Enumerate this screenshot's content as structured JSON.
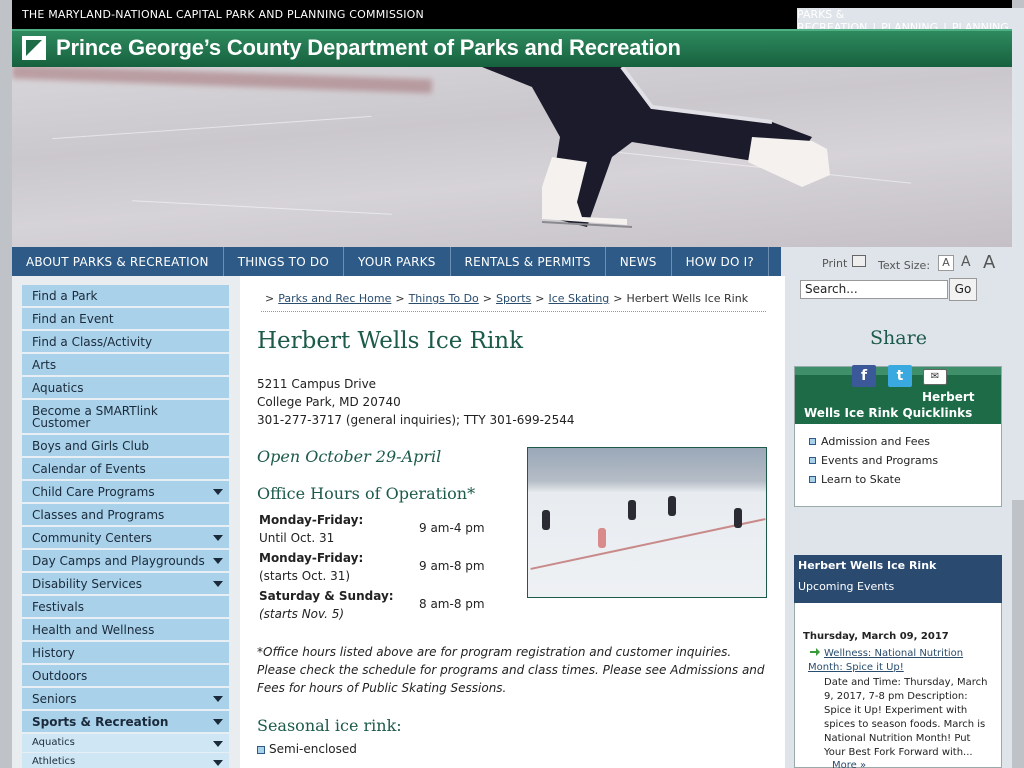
{
  "topbar": {
    "org": "THE MARYLAND-NATIONAL CAPITAL PARK AND PLANNING COMMISSION",
    "links": [
      "PARKS & RECREATION",
      "PLANNING",
      "PLANNING BOARD"
    ],
    "sep": "|"
  },
  "banner": {
    "title": "Prince George’s County Department of Parks and Recreation"
  },
  "nav": {
    "items": [
      "ABOUT PARKS & RECREATION",
      "THINGS TO DO",
      "YOUR PARKS",
      "RENTALS & PERMITS",
      "NEWS",
      "HOW DO I?"
    ],
    "print": "Print",
    "text_size": "Text Size:",
    "size_small": "A",
    "size_medium": "A",
    "size_large": "A"
  },
  "sidebar": {
    "items": [
      "Find a Park",
      "Find an Event",
      "Find a Class/Activity",
      "Arts",
      "Aquatics",
      "Become a SMARTlink Customer",
      "Boys and Girls Club",
      "Calendar of Events",
      "Child Care Programs",
      "Classes and Programs",
      "Community Centers",
      "Day Camps and Playgrounds",
      "Disability Services",
      "Festivals",
      "Health and Wellness",
      "History",
      "Outdoors",
      "Seniors",
      "Sports & Recreation"
    ],
    "sub_items": [
      "Aquatics",
      "Athletics"
    ]
  },
  "breadcrumb": {
    "links": [
      "Parks and Rec Home",
      "Things To Do",
      "Sports",
      "Ice Skating"
    ],
    "current": "Herbert Wells Ice Rink",
    "gt": ">"
  },
  "main": {
    "title": "Herbert Wells Ice Rink",
    "address1": "5211 Campus Drive",
    "address2": "College Park, MD 20740",
    "phone": "301-277-3717 (general inquiries);  TTY 301-699-2544",
    "open": "Open October 29-April",
    "office_heading": "Office Hours of Operation*",
    "hours": [
      {
        "day": "Monday-Friday:",
        "note": "Until Oct. 31",
        "time": "9 am-4 pm"
      },
      {
        "day": "Monday-Friday:",
        "note": "(starts Oct. 31)",
        "time": "9 am-8 pm"
      },
      {
        "day": "Saturday & Sunday:",
        "note": "(starts Nov. 5)",
        "time": "8 am-8 pm"
      }
    ],
    "footnote": "*Office hours listed above are for program registration and customer inquiries. Please check the schedule for programs and class times. Please see Admissions and Fees for hours of Public Skating Sessions.",
    "seasonal_heading": "Seasonal ice rink:",
    "seasonal_items": [
      "Semi-enclosed"
    ]
  },
  "search": {
    "value": "Search...",
    "button": "Go"
  },
  "share": {
    "title": "Share",
    "icon_fb": "f",
    "icon_tw": "t",
    "icon_em": "✉"
  },
  "quicklinks": {
    "heading_line1": "Herbert",
    "heading_line2": "Wells Ice Rink Quicklinks",
    "items": [
      "Admission and Fees",
      "Events and Programs",
      "Learn to Skate"
    ]
  },
  "events": {
    "title": "Herbert Wells Ice Rink",
    "subtitle": "Upcoming Events",
    "date": "Thursday, March 09, 2017",
    "link": "Wellness: National Nutrition Month: Spice it Up!",
    "desc": "Date and Time: Thursday, March 9, 2017, 7-8 pm Description: Spice it Up!  Experiment with spices to season foods. March is National Nutrition Month! Put Your Best Fork Forward with...",
    "more": "More »"
  },
  "colors": {
    "brand_green": "#1d6b47",
    "nav_blue": "#2d5a86",
    "sidebar_blue": "#a9d1ea",
    "title_green": "#1c5a4a"
  }
}
